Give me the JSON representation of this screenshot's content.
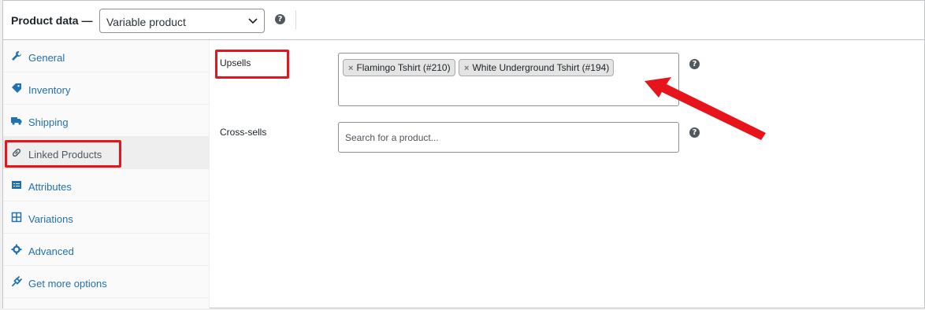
{
  "header": {
    "title": "Product data —",
    "product_type": "Variable product",
    "help": "?"
  },
  "sidebar": {
    "items": [
      {
        "label": "General",
        "icon": "wrench-icon"
      },
      {
        "label": "Inventory",
        "icon": "tag-icon"
      },
      {
        "label": "Shipping",
        "icon": "truck-icon"
      },
      {
        "label": "Linked Products",
        "icon": "link-icon",
        "active": true
      },
      {
        "label": "Attributes",
        "icon": "list-icon"
      },
      {
        "label": "Variations",
        "icon": "grid-icon"
      },
      {
        "label": "Advanced",
        "icon": "gear-icon"
      },
      {
        "label": "Get more options",
        "icon": "plugin-icon"
      }
    ]
  },
  "linked": {
    "upsells_label": "Upsells",
    "upsells": [
      {
        "label": "Flamingo Tshirt (#210)"
      },
      {
        "label": "White Underground Tshirt (#194)"
      }
    ],
    "crosssells_label": "Cross-sells",
    "crosssells_placeholder": "Search for a product...",
    "help": "?"
  },
  "colors": {
    "accent": "#2271b1",
    "highlight": "#e8141c",
    "border": "#c3c4c7"
  }
}
